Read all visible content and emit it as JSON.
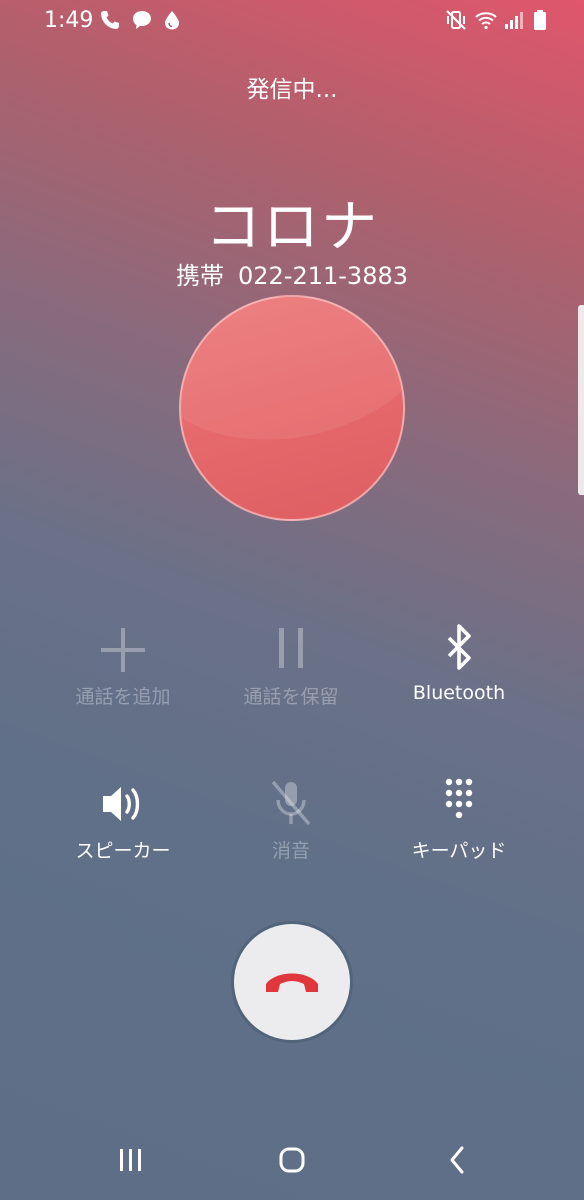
{
  "status_bar": {
    "time": "1:49",
    "left_icons": [
      "phone-icon",
      "chat-bubble-icon",
      "drop-icon"
    ],
    "right_icons": [
      "vibrate-mute-icon",
      "wifi-icon",
      "signal-icon",
      "battery-icon"
    ]
  },
  "call": {
    "status": "発信中...",
    "contact_name": "コロナ",
    "phone_type": "携帯",
    "phone_number": "022-211-3883"
  },
  "controls": {
    "add_call": "通話を追加",
    "hold_call": "通話を保留",
    "bluetooth": "Bluetooth",
    "speaker": "スピーカー",
    "mute": "消音",
    "keypad": "キーパッド"
  },
  "colors": {
    "end_call_icon": "#e0373c",
    "gradient_top": "#e0566c",
    "gradient_bottom": "#5d6e86"
  }
}
